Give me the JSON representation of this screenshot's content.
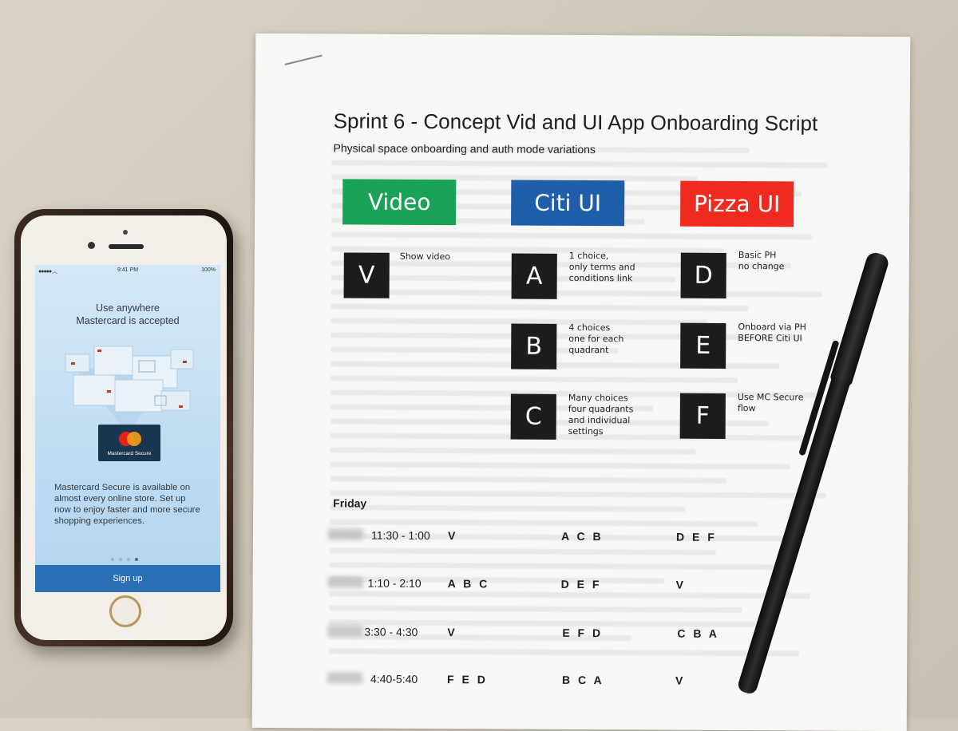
{
  "phone": {
    "status_time": "9:41 PM",
    "status_battery": "100%",
    "headline_line1": "Use anywhere",
    "headline_line2": "Mastercard is accepted",
    "card_label": "Mastercard Secure",
    "body": "Mastercard Secure is available on almost every online store. Set up now to enjoy faster and more secure shopping experiences.",
    "pager_active_index": 3,
    "signup_label": "Sign up",
    "colors": {
      "signup_bg": "#2a6fb5",
      "card_bg": "#18364f",
      "mc_red": "#e4231b",
      "mc_orange": "#f79e1b"
    }
  },
  "paper": {
    "title": "Sprint 6 - Concept Vid and UI App Onboarding Script",
    "subtitle": "Physical space onboarding and auth mode variations",
    "banners": [
      {
        "label": "Video",
        "color": "#1aa356"
      },
      {
        "label": "Citi UI",
        "color": "#1f5faa"
      },
      {
        "label": "Pizza UI",
        "color": "#ef2b1f"
      }
    ],
    "options": {
      "V": {
        "letter": "V",
        "lines": [
          "Show video"
        ]
      },
      "A": {
        "letter": "A",
        "lines": [
          "1 choice,",
          "only terms and",
          "conditions link"
        ]
      },
      "B": {
        "letter": "B",
        "lines": [
          "4 choices",
          "one for each",
          "quadrant"
        ]
      },
      "C": {
        "letter": "C",
        "lines": [
          "Many choices",
          "four quadrants",
          "and individual",
          "settings"
        ]
      },
      "D": {
        "letter": "D",
        "lines": [
          "Basic PH",
          "no change"
        ]
      },
      "E": {
        "letter": "E",
        "lines": [
          "Onboard via PH",
          "BEFORE Citi UI"
        ]
      },
      "F": {
        "letter": "F",
        "lines": [
          "Use MC Secure",
          "flow"
        ]
      }
    },
    "schedule_day": "Friday",
    "schedule": [
      {
        "time": "11:30 - 1:00",
        "cols": [
          "V",
          "A C B",
          "D E F"
        ]
      },
      {
        "time": "1:10 - 2:10",
        "cols": [
          "A B C",
          "D E F",
          "V"
        ]
      },
      {
        "time": "3:30 - 4:30",
        "cols": [
          "V",
          "E F D",
          "C B A"
        ]
      },
      {
        "time": "4:40-5:40",
        "cols": [
          "F E D",
          "B C A",
          "V"
        ]
      }
    ]
  }
}
